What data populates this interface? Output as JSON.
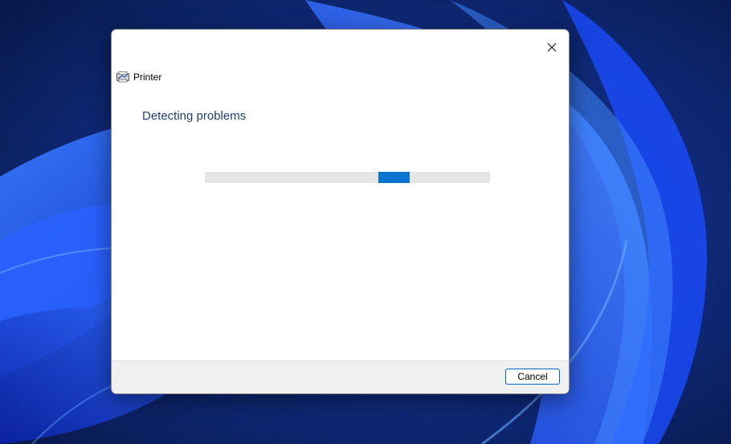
{
  "dialog": {
    "title": "Printer",
    "heading": "Detecting problems",
    "cancel_label": "Cancel",
    "progress_state": "indeterminate"
  },
  "icons": {
    "close": "close-icon",
    "printer": "printer-icon"
  },
  "colors": {
    "heading": "#1f3e78",
    "progress_chunk": "#0a74d0",
    "progress_track": "#e6e6e6",
    "footer": "#f0f0f0",
    "button_border": "#0067c0",
    "wallpaper_dark": "#0a1f5c",
    "wallpaper_accent": "#1a4cff"
  }
}
